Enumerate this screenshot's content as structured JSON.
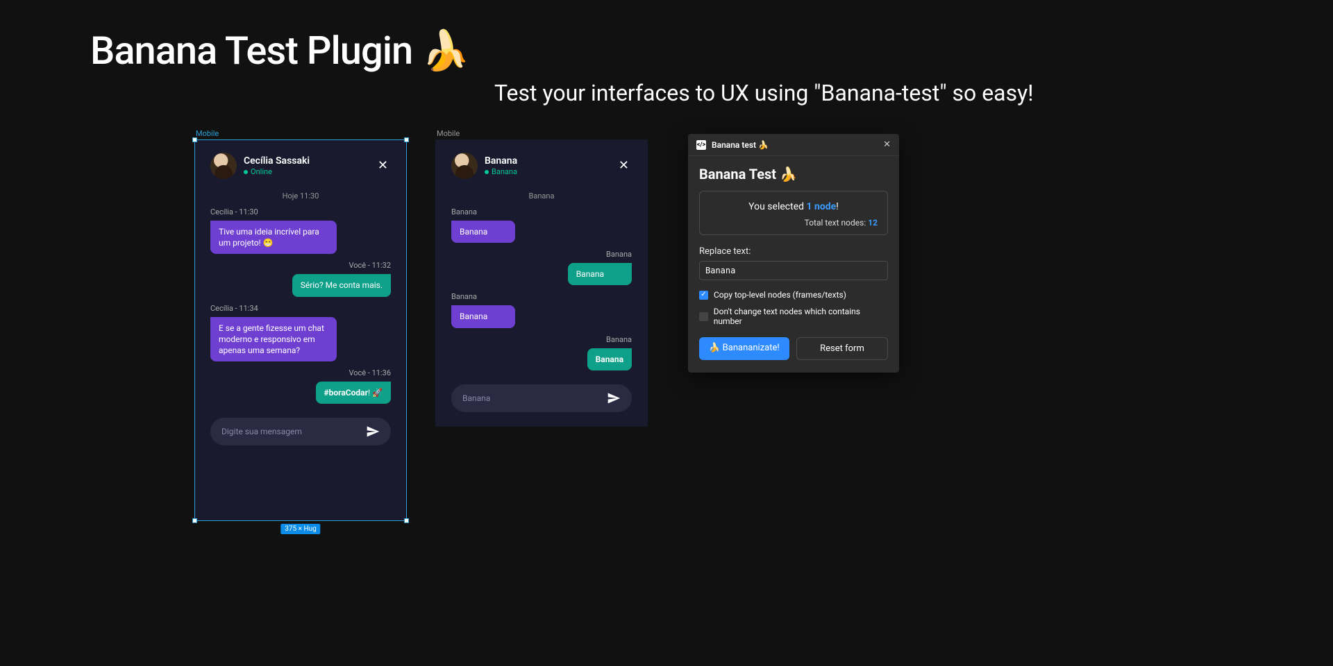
{
  "page": {
    "title": "Banana Test  Plugin 🍌",
    "subtitle": "Test your interfaces to UX using \"Banana-test\"  so easy!"
  },
  "frame_a": {
    "label": "Mobile",
    "size_badge": "375 × Hug",
    "chat": {
      "contact_name": "Cecília Sassaki",
      "status": "Online",
      "date": "Hoje 11:30",
      "msgs": {
        "m1_meta": "Cecília - 11:30",
        "m1_text": "Tive uma ideia incrível para um projeto! 😁",
        "m2_meta": "Você - 11:32",
        "m2_text": "Sério? Me conta mais.",
        "m3_meta": "Cecília - 11:34",
        "m3_text": "E se a gente fizesse um chat moderno e responsivo em apenas uma semana?",
        "m4_meta": "Você - 11:36",
        "m4_bold": "#boraCodar",
        "m4_rest": "! 🚀"
      },
      "input_placeholder": "Digite sua mensagem"
    }
  },
  "frame_b": {
    "label": "Mobile",
    "chat": {
      "contact_name": "Banana",
      "status": "Banana",
      "date": "Banana",
      "msgs": {
        "m1_meta": "Banana",
        "m1_text": "Banana",
        "m2_meta": "Banana",
        "m2_text": "Banana",
        "m3_meta": "Banana",
        "m3_text": "Banana",
        "m4_meta": "Banana",
        "m4_text": "Banana"
      },
      "input_placeholder": "Banana"
    }
  },
  "plugin": {
    "titlebar": "Banana test 🍌",
    "heading": "Banana Test 🍌",
    "status": {
      "prefix": "You selected ",
      "node_count": "1 node",
      "suffix": "!",
      "total_label": "Total text nodes: ",
      "total_count": "12"
    },
    "replace_label": "Replace text:",
    "replace_value": "Banana",
    "checks": {
      "copy_top": "Copy top-level nodes (frames/texts)",
      "skip_numbers": "Don't change text nodes which contains number"
    },
    "buttons": {
      "primary": "🍌 Banananizate!",
      "secondary": "Reset form"
    }
  }
}
